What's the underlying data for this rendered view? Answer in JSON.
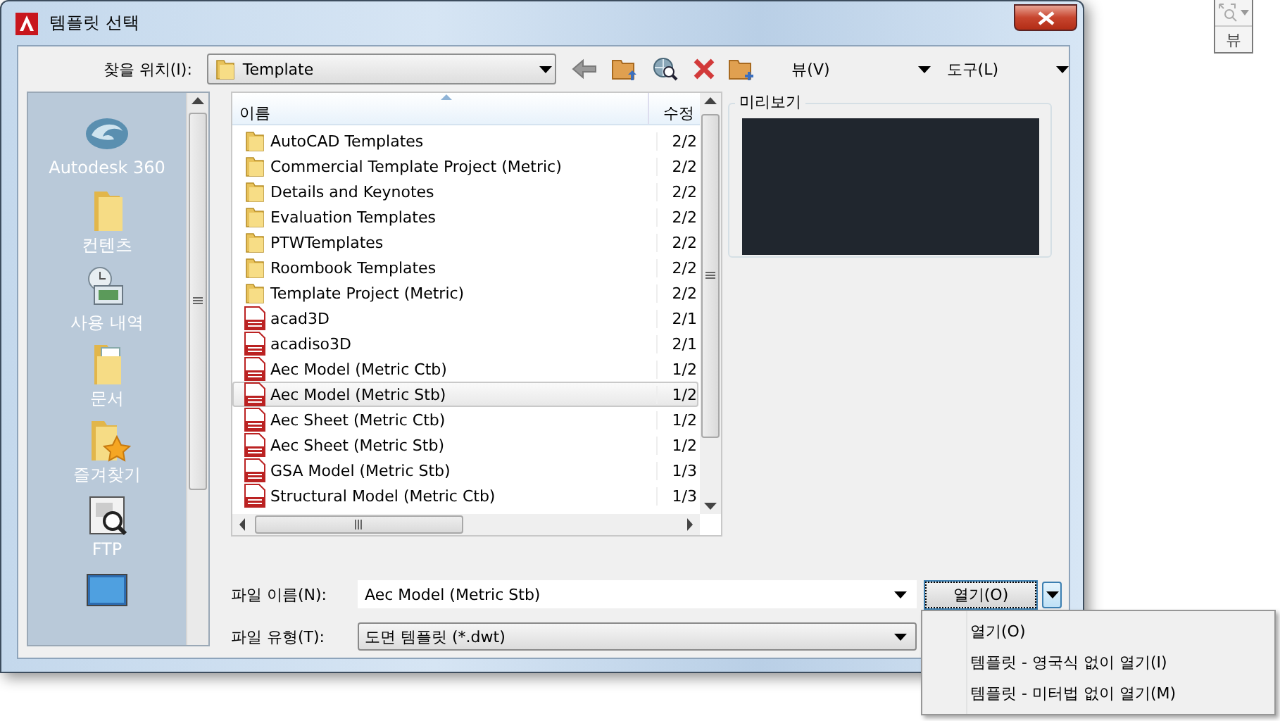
{
  "window": {
    "title": "템플릿 선택"
  },
  "look_in": {
    "label": "찾을 위치(I):",
    "value": "Template"
  },
  "toolbar": {
    "view": "뷰(V)",
    "tools": "도구(L)"
  },
  "places": [
    {
      "label": "Autodesk 360",
      "kind": "cloud"
    },
    {
      "label": "컨텐츠",
      "kind": "folder"
    },
    {
      "label": "사용 내역",
      "kind": "history"
    },
    {
      "label": "문서",
      "kind": "documents"
    },
    {
      "label": "즐겨찾기",
      "kind": "favorites"
    },
    {
      "label": "FTP",
      "kind": "ftp"
    },
    {
      "kind": "desktop"
    }
  ],
  "file_list": {
    "columns": [
      "이름",
      "수정"
    ],
    "rows": [
      {
        "name": "AutoCAD Templates",
        "kind": "folder",
        "modified": "2/2",
        "selected": false
      },
      {
        "name": "Commercial Template Project (Metric)",
        "kind": "folder",
        "modified": "2/2",
        "selected": false
      },
      {
        "name": "Details and Keynotes",
        "kind": "folder",
        "modified": "2/2",
        "selected": false
      },
      {
        "name": "Evaluation Templates",
        "kind": "folder",
        "modified": "2/2",
        "selected": false
      },
      {
        "name": "PTWTemplates",
        "kind": "folder",
        "modified": "2/2",
        "selected": false
      },
      {
        "name": "Roombook Templates",
        "kind": "folder",
        "modified": "2/2",
        "selected": false
      },
      {
        "name": "Template Project (Metric)",
        "kind": "folder",
        "modified": "2/2",
        "selected": false
      },
      {
        "name": "acad3D",
        "kind": "dwt",
        "modified": "2/1",
        "selected": false
      },
      {
        "name": "acadiso3D",
        "kind": "dwt",
        "modified": "2/1",
        "selected": false
      },
      {
        "name": "Aec Model (Metric Ctb)",
        "kind": "dwt",
        "modified": "1/2",
        "selected": false
      },
      {
        "name": "Aec Model (Metric Stb)",
        "kind": "dwt",
        "modified": "1/2",
        "selected": true
      },
      {
        "name": "Aec Sheet (Metric Ctb)",
        "kind": "dwt",
        "modified": "1/2",
        "selected": false
      },
      {
        "name": "Aec Sheet (Metric Stb)",
        "kind": "dwt",
        "modified": "1/2",
        "selected": false
      },
      {
        "name": "GSA Model (Metric Stb)",
        "kind": "dwt",
        "modified": "1/3",
        "selected": false
      },
      {
        "name": "Structural Model (Metric Ctb)",
        "kind": "dwt",
        "modified": "1/3",
        "selected": false
      }
    ]
  },
  "preview": {
    "label": "미리보기"
  },
  "file_name": {
    "label": "파일 이름(N):",
    "value": "Aec Model (Metric Stb)"
  },
  "file_type": {
    "label": "파일 유형(T):",
    "value": "도면 템플릿 (*.dwt)"
  },
  "open_button": {
    "label": "열기(O)"
  },
  "open_menu": [
    "열기(O)",
    "템플릿 - 영국식 없이 열기(I)",
    "템플릿 - 미터법 없이 열기(M)"
  ],
  "view_widget": {
    "label": "뷰"
  }
}
